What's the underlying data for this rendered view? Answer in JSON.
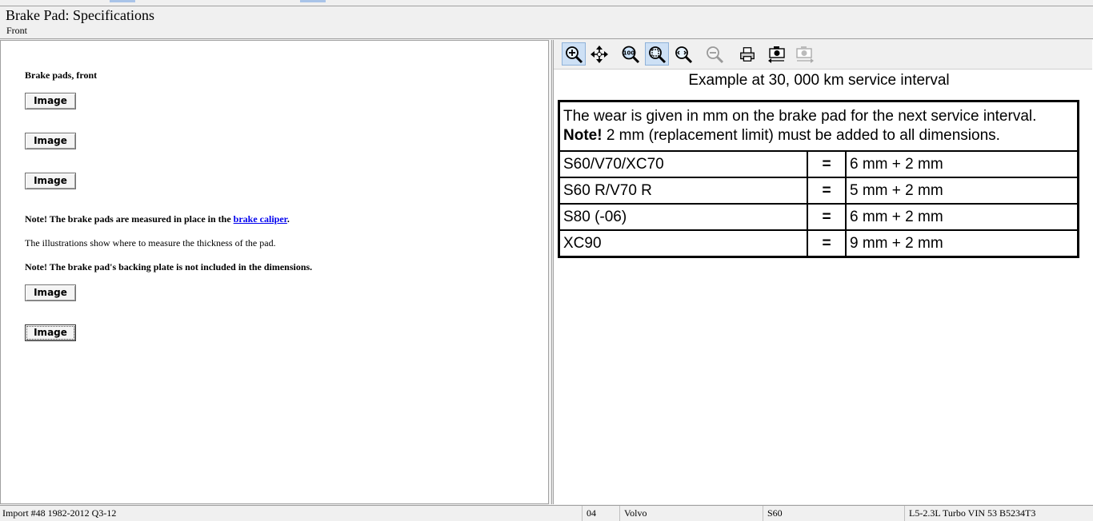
{
  "header": {
    "title": "Brake Pad:  Specifications",
    "subtitle": "Front"
  },
  "left": {
    "heading": "Brake pads, front",
    "image_button_label": "Image",
    "note1_prefix": "Note! The brake pads are measured in place in the ",
    "note1_link": "brake caliper",
    "note1_suffix": ".",
    "illustrations_text": "The illustrations show where to measure the thickness of the pad.",
    "note2": "Note! The brake pad's backing plate is not included in the dimensions."
  },
  "toolbar": {
    "icons": [
      "zoom-in-icon",
      "pan-icon",
      "zoom-100-icon",
      "zoom-fit-icon",
      "zoom-window-icon",
      "zoom-out-icon",
      "print-icon",
      "copy-image-icon",
      "save-image-icon"
    ]
  },
  "spec": {
    "title": "Example at 30, 000 km service interval",
    "note_line1": "The wear is given in mm on the brake pad for the next service interval.",
    "note_bold": "Note!",
    "note_line2": " 2 mm (replacement limit) must be added to all dimensions.",
    "rows": [
      {
        "model": "S60/V70/XC70",
        "eq": "=",
        "value": "6 mm + 2 mm"
      },
      {
        "model": "S60 R/V70 R",
        "eq": "=",
        "value": "5 mm + 2 mm"
      },
      {
        "model": "S80 (-06)",
        "eq": "=",
        "value": "6 mm + 2 mm"
      },
      {
        "model": "XC90",
        "eq": "=",
        "value": "9 mm + 2 mm"
      }
    ]
  },
  "status": {
    "import": "Import #48 1982-2012 Q3-12",
    "code": "04",
    "make": "Volvo",
    "model": "S60",
    "engine": "L5-2.3L Turbo VIN 53 B5234T3"
  },
  "colors": {
    "link": "#0000cc",
    "active_tool_bg": "#cde0f5",
    "chrome_bg": "#f0f0f0"
  }
}
